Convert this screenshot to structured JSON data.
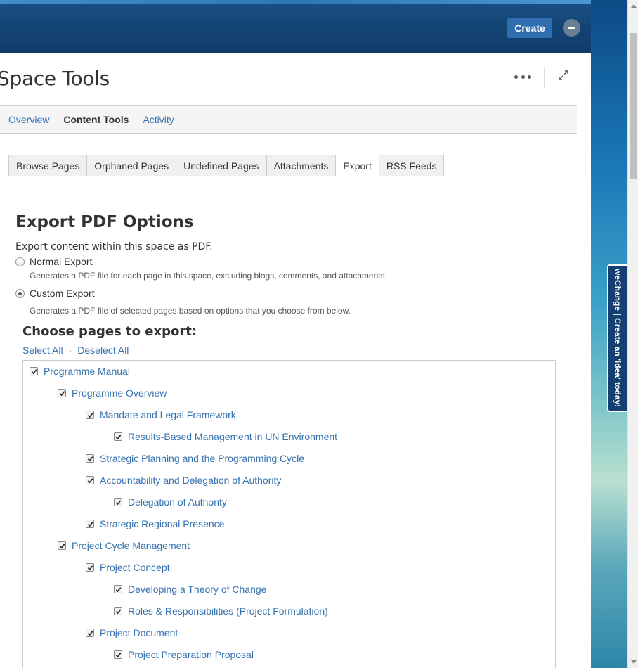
{
  "header": {
    "create_label": "Create"
  },
  "page": {
    "title": "Space Tools"
  },
  "subnav": [
    {
      "label": "Overview",
      "active": false
    },
    {
      "label": "Content Tools",
      "active": true
    },
    {
      "label": "Activity",
      "active": false
    }
  ],
  "tabs": [
    {
      "label": "Browse Pages",
      "active": false
    },
    {
      "label": "Orphaned Pages",
      "active": false
    },
    {
      "label": "Undefined Pages",
      "active": false
    },
    {
      "label": "Attachments",
      "active": false
    },
    {
      "label": "Export",
      "active": true
    },
    {
      "label": "RSS Feeds",
      "active": false
    }
  ],
  "export": {
    "title": "Export PDF Options",
    "description": "Export content within this space as PDF.",
    "normal_label": "Normal Export",
    "normal_help": "Generates a PDF file for each page in this space, excluding blogs, comments, and attachments.",
    "custom_label": "Custom Export",
    "custom_help": "Generates a PDF file of selected pages based on options that you choose from below.",
    "choose_title": "Choose pages to export:",
    "select_all": "Select All",
    "separator": "·",
    "deselect_all": "Deselect All"
  },
  "pages_tree": [
    {
      "label": "Programme Manual",
      "level": 0,
      "checked": true
    },
    {
      "label": "Programme Overview",
      "level": 1,
      "checked": true
    },
    {
      "label": "Mandate and Legal Framework",
      "level": 2,
      "checked": true
    },
    {
      "label": "Results-Based Management in UN Environment",
      "level": 3,
      "checked": true
    },
    {
      "label": "Strategic Planning and the Programming Cycle",
      "level": 2,
      "checked": true
    },
    {
      "label": "Accountability and Delegation of Authority",
      "level": 2,
      "checked": true
    },
    {
      "label": "Delegation of Authority",
      "level": 3,
      "checked": true
    },
    {
      "label": "Strategic Regional Presence",
      "level": 2,
      "checked": true
    },
    {
      "label": "Project Cycle Management",
      "level": 1,
      "checked": true
    },
    {
      "label": "Project Concept",
      "level": 2,
      "checked": true
    },
    {
      "label": "Developing a Theory of Change",
      "level": 3,
      "checked": true
    },
    {
      "label": "Roles & Responsibilities (Project Formulation)",
      "level": 3,
      "checked": true
    },
    {
      "label": "Project Document",
      "level": 2,
      "checked": true
    },
    {
      "label": "Project Preparation Proposal",
      "level": 3,
      "checked": true
    }
  ],
  "feedback": {
    "label": "weChange | Create an 'idea' today!"
  }
}
